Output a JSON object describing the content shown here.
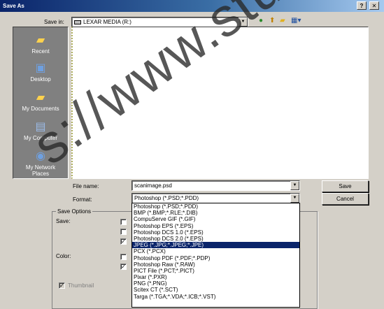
{
  "window": {
    "title": "Save As",
    "help_btn": "?",
    "close_btn": "✕"
  },
  "save_in": {
    "label": "Save in:",
    "value": "LEXAR MEDIA (R:)",
    "icon": "drive-icon"
  },
  "places": [
    {
      "label": "Recent",
      "icon": "recent-folder-icon"
    },
    {
      "label": "Desktop",
      "icon": "desktop-icon"
    },
    {
      "label": "My Documents",
      "icon": "my-documents-icon"
    },
    {
      "label": "My Computer",
      "icon": "my-computer-icon"
    },
    {
      "label": "My Network Places",
      "icon": "network-icon"
    }
  ],
  "file_name": {
    "label": "File name:",
    "value": "scanimage.psd"
  },
  "format": {
    "label": "Format:",
    "value": "Photoshop (*.PSD;*.PDD)"
  },
  "buttons": {
    "save": "Save",
    "cancel": "Cancel"
  },
  "save_options": {
    "group_label": "Save Options",
    "save_label": "Save:",
    "color_label": "Color:",
    "thumbnail_label": "Thumbnail"
  },
  "format_options": [
    "Photoshop (*.PSD;*.PDD)",
    "BMP (*.BMP;*.RLE;*.DIB)",
    "CompuServe GIF (*.GIF)",
    "Photoshop EPS (*.EPS)",
    "Photoshop DCS 1.0 (*.EPS)",
    "Photoshop DCS 2.0 (*.EPS)",
    "JPEG (*.JPG;*.JPEG;*.JPE)",
    "PCX (*.PCX)",
    "Photoshop PDF (*.PDF;*.PDP)",
    "Photoshop Raw (*.RAW)",
    "PICT File (*.PCT;*.PICT)",
    "Pixar (*.PXR)",
    "PNG (*.PNG)",
    "Scitex CT (*.SCT)",
    "Targa (*.TGA;*.VDA;*.ICB;*.VST)"
  ],
  "selected_format": "JPEG (*.JPG;*.JPEG;*.JPE)",
  "watermark": "s://www.studie",
  "colors": {
    "title_start": "#0a246a",
    "title_end": "#a6caf0",
    "selection": "#0a246a",
    "face": "#d4d0c8",
    "places_bg": "#808080"
  }
}
